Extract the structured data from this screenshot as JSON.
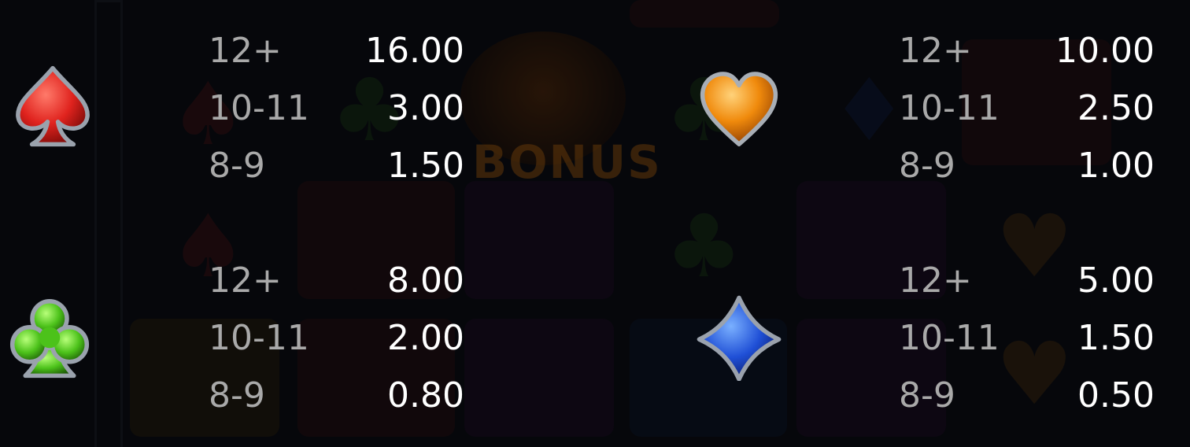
{
  "paytable": [
    {
      "symbol": "red-spade",
      "icon": "spade-icon",
      "color": "#e0231e",
      "rows": [
        {
          "count": "12+",
          "payout": "16.00"
        },
        {
          "count": "10-11",
          "payout": "3.00"
        },
        {
          "count": "8-9",
          "payout": "1.50"
        }
      ]
    },
    {
      "symbol": "orange-heart",
      "icon": "heart-icon",
      "color": "#f08a0c",
      "rows": [
        {
          "count": "12+",
          "payout": "10.00"
        },
        {
          "count": "10-11",
          "payout": "2.50"
        },
        {
          "count": "8-9",
          "payout": "1.00"
        }
      ]
    },
    {
      "symbol": "green-club",
      "icon": "club-icon",
      "color": "#4cc21a",
      "rows": [
        {
          "count": "12+",
          "payout": "8.00"
        },
        {
          "count": "10-11",
          "payout": "2.00"
        },
        {
          "count": "8-9",
          "payout": "0.80"
        }
      ]
    },
    {
      "symbol": "blue-diamond",
      "icon": "diamond-icon",
      "color": "#1f4fd6",
      "rows": [
        {
          "count": "12+",
          "payout": "5.00"
        },
        {
          "count": "10-11",
          "payout": "1.50"
        },
        {
          "count": "8-9",
          "payout": "0.50"
        }
      ]
    }
  ],
  "background_text": "BONUS"
}
